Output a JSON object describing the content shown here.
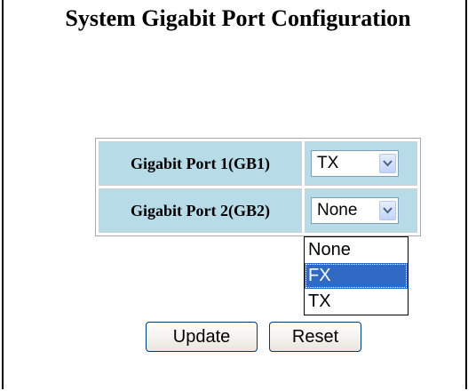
{
  "page": {
    "title": "System Gigabit Port Configuration"
  },
  "ports": [
    {
      "label": "Gigabit Port 1(GB1)",
      "value": "TX"
    },
    {
      "label": "Gigabit Port 2(GB2)",
      "value": "None"
    }
  ],
  "dropdown": {
    "options": [
      "None",
      "FX",
      "TX"
    ],
    "highlighted": "FX"
  },
  "buttons": {
    "update": "Update",
    "reset": "Reset"
  },
  "icons": {
    "select_arrow": "chevron-down-icon"
  },
  "colors": {
    "label_bg": "#b8dbe8",
    "highlight": "#316ac5"
  }
}
